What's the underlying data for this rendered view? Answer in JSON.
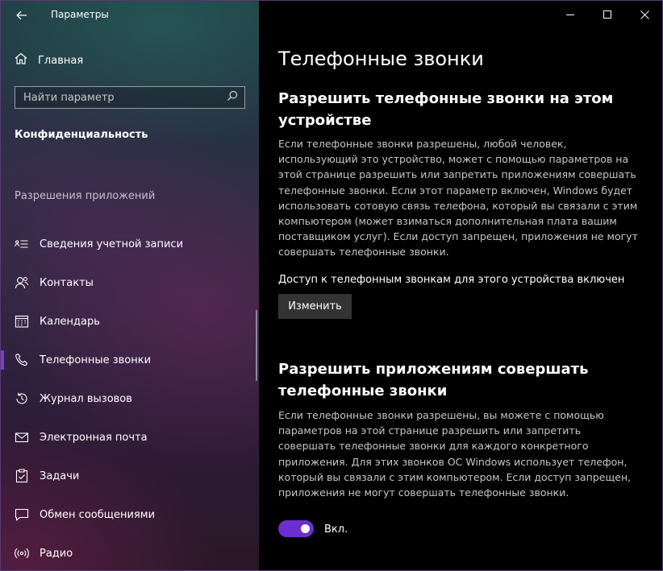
{
  "window": {
    "app_title": "Параметры"
  },
  "sidebar": {
    "home_label": "Главная",
    "search": {
      "placeholder": "Найти параметр",
      "value": ""
    },
    "section_title": "Конфиденциальность",
    "group_header": "Разрешения приложений",
    "items": [
      {
        "label": "Сведения учетной записи",
        "icon": "account-info-icon"
      },
      {
        "label": "Контакты",
        "icon": "contacts-icon"
      },
      {
        "label": "Календарь",
        "icon": "calendar-icon"
      },
      {
        "label": "Телефонные звонки",
        "icon": "phone-icon",
        "active": true
      },
      {
        "label": "Журнал вызовов",
        "icon": "call-history-icon"
      },
      {
        "label": "Электронная почта",
        "icon": "email-icon"
      },
      {
        "label": "Задачи",
        "icon": "tasks-icon"
      },
      {
        "label": "Обмен сообщениями",
        "icon": "messaging-icon"
      },
      {
        "label": "Радио",
        "icon": "radio-icon"
      }
    ]
  },
  "main": {
    "page_title": "Телефонные звонки",
    "device_section": {
      "heading": "Разрешить телефонные звонки на этом устройстве",
      "description": "Если телефонные звонки разрешены, любой человек, использующий это устройство, может с помощью параметров на этой странице разрешить или запретить приложениям совершать телефонные звонки. Если этот параметр включен, Windows будет использовать сотовую связь телефона, который вы связали с этим компьютером (может взиматься дополнительная плата вашим поставщиком услуг). Если доступ запрещен, приложения не могут совершать телефонные звонки.",
      "status": "Доступ к телефонным звонкам для этого устройства включен",
      "change_button": "Изменить"
    },
    "apps_section": {
      "heading": "Разрешить приложениям совершать телефонные звонки",
      "description": "Если телефонные звонки разрешены, вы можете с помощью параметров на этой странице разрешить или запретить совершать телефонные звонки для каждого конкретного приложения. Для этих звонков ОС Windows использует телефон, который вы связали с этим компьютером. Если доступ запрещен, приложения не могут совершать телефонные звонки.",
      "toggle_state": true,
      "toggle_label": "Вкл."
    }
  },
  "colors": {
    "accent": "#6b2fd0",
    "active_indicator": "#7a3cd6",
    "button_bg": "#333333",
    "main_bg": "#000000"
  }
}
